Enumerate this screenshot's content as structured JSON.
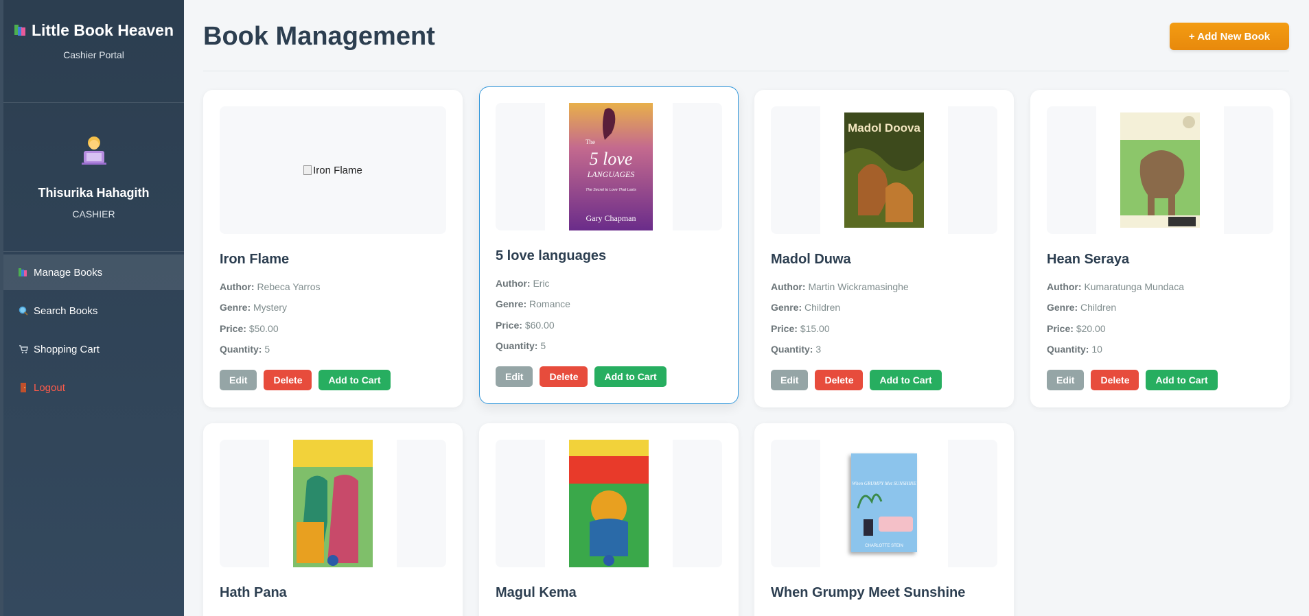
{
  "brand": {
    "title": "Little Book Heaven",
    "subtitle": "Cashier Portal"
  },
  "user": {
    "name": "Thisurika Hahagith",
    "role": "CASHIER"
  },
  "nav": [
    {
      "label": "Manage Books",
      "icon": "books-icon",
      "active": true
    },
    {
      "label": "Search Books",
      "icon": "magnifier-icon"
    },
    {
      "label": "Shopping Cart",
      "icon": "cart-icon"
    },
    {
      "label": "Logout",
      "icon": "door-icon"
    }
  ],
  "header": {
    "title": "Book Management",
    "add_button": "+ Add New Book"
  },
  "labels": {
    "author": "Author:",
    "genre": "Genre:",
    "price": "Price:",
    "quantity": "Quantity:",
    "edit": "Edit",
    "delete": "Delete",
    "add_to_cart": "Add to Cart"
  },
  "books": [
    {
      "title": "Iron Flame",
      "author": "Rebeca Yarros",
      "genre": "Mystery",
      "price": "$50.00",
      "quantity": "5",
      "cover_alt": "Iron Flame",
      "cover": "broken-image"
    },
    {
      "title": "5 love languages",
      "author": "Eric",
      "genre": "Romance",
      "price": "$60.00",
      "quantity": "5",
      "cover": "5-love-languages-cover",
      "cover_text": [
        "The",
        "5 love",
        "LANGUAGES",
        "The Secret to Love That Lasts",
        "Gary Chapman"
      ]
    },
    {
      "title": "Madol Duwa",
      "author": "Martin Wickramasinghe",
      "genre": "Children",
      "price": "$15.00",
      "quantity": "3",
      "cover": "madol-doova-cover",
      "cover_text": [
        "Madol Doova"
      ]
    },
    {
      "title": "Hean Seraya",
      "author": "Kumaratunga Mundaca",
      "genre": "Children",
      "price": "$20.00",
      "quantity": "10",
      "cover": "hean-seraya-cover"
    },
    {
      "title": "Hath Pana",
      "cover": "hath-pana-cover"
    },
    {
      "title": "Magul Kema",
      "cover": "magul-kema-cover"
    },
    {
      "title": "When Grumpy Meet Sunshine",
      "cover": "when-grumpy-met-sunshine-cover",
      "cover_text": [
        "When GRUMPY Met SUNSHINE",
        "CHARLOTTE STEIN"
      ]
    }
  ]
}
